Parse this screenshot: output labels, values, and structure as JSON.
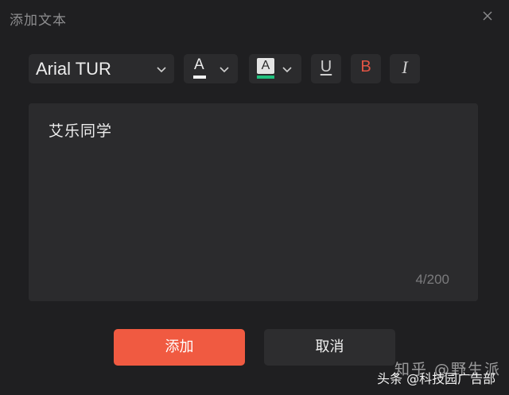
{
  "dialog": {
    "title": "添加文本",
    "close_icon": "close-icon"
  },
  "toolbar": {
    "font_family": "Arial TUR",
    "text_color_glyph": "A",
    "text_color": "#f2f2f2",
    "highlight_glyph": "A",
    "highlight_color": "#20c07e",
    "underline_glyph": "U",
    "bold_glyph": "B",
    "bold_color": "#e25545",
    "italic_glyph": "I"
  },
  "editor": {
    "content": "艾乐同学",
    "char_count": "4/200"
  },
  "actions": {
    "add_label": "添加",
    "add_color": "#f05a41",
    "cancel_label": "取消"
  },
  "watermark": {
    "main": "知乎 @野生派",
    "secondary": "头条 @科技园广告部"
  }
}
